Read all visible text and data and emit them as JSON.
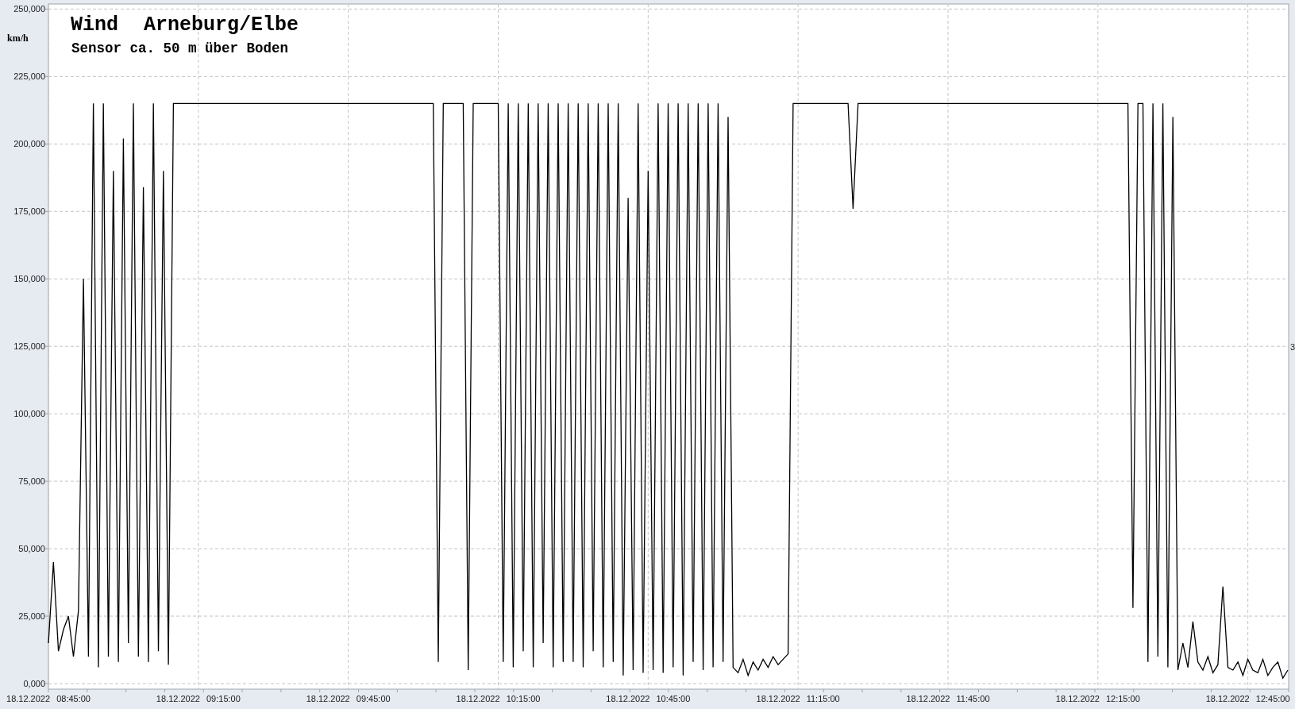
{
  "chart": {
    "title_parts": [
      "Wind",
      "Arneburg/Elbe"
    ],
    "subtitle": "Sensor ca. 50 m über Boden",
    "right_marker": "3",
    "chart_data": {
      "type": "line",
      "ylabel": "km/h",
      "ylim": [
        0,
        250000
      ],
      "yticks": [
        {
          "value": 0,
          "label": "0,000"
        },
        {
          "value": 25000,
          "label": "25,000"
        },
        {
          "value": 50000,
          "label": "50,000"
        },
        {
          "value": 75000,
          "label": "75,000"
        },
        {
          "value": 100000,
          "label": "100,000"
        },
        {
          "value": 125000,
          "label": "125,000"
        },
        {
          "value": 150000,
          "label": "150,000"
        },
        {
          "value": 175000,
          "label": "175,000"
        },
        {
          "value": 200000,
          "label": "200,000"
        },
        {
          "value": 225000,
          "label": "225,000"
        },
        {
          "value": 250000,
          "label": "250,000"
        }
      ],
      "categories": [
        "18.12.2022 08:45:00",
        null,
        null,
        null,
        null,
        null,
        null,
        null,
        null,
        null,
        null,
        null,
        null,
        null,
        null,
        null,
        null,
        null,
        null,
        null,
        null,
        null,
        null,
        null,
        null,
        null,
        null,
        null,
        null,
        null,
        "18.12.2022 09:15:00",
        null,
        null,
        null,
        null,
        null,
        null,
        null,
        null,
        null,
        null,
        null,
        null,
        null,
        null,
        null,
        null,
        null,
        null,
        null,
        null,
        null,
        null,
        null,
        null,
        null,
        null,
        null,
        null,
        null,
        "18.12.2022 09:45:00",
        null,
        null,
        null,
        null,
        null,
        null,
        null,
        null,
        null,
        null,
        null,
        null,
        null,
        null,
        null,
        null,
        null,
        null,
        null,
        null,
        null,
        null,
        null,
        null,
        null,
        null,
        null,
        null,
        null,
        "18.12.2022 10:15:00",
        null,
        null,
        null,
        null,
        null,
        null,
        null,
        null,
        null,
        null,
        null,
        null,
        null,
        null,
        null,
        null,
        null,
        null,
        null,
        null,
        null,
        null,
        null,
        null,
        null,
        null,
        null,
        null,
        null,
        "18.12.2022 10:45:00",
        null,
        null,
        null,
        null,
        null,
        null,
        null,
        null,
        null,
        null,
        null,
        null,
        null,
        null,
        null,
        null,
        null,
        null,
        null,
        null,
        null,
        null,
        null,
        null,
        null,
        null,
        null,
        null,
        null,
        "18.12.2022 11:15:00",
        null,
        null,
        null,
        null,
        null,
        null,
        null,
        null,
        null,
        null,
        null,
        null,
        null,
        null,
        null,
        null,
        null,
        null,
        null,
        null,
        null,
        null,
        null,
        null,
        null,
        null,
        null,
        null,
        null,
        "18.12.2022 11:45:00",
        null,
        null,
        null,
        null,
        null,
        null,
        null,
        null,
        null,
        null,
        null,
        null,
        null,
        null,
        null,
        null,
        null,
        null,
        null,
        null,
        null,
        null,
        null,
        null,
        null,
        null,
        null,
        null,
        null,
        "18.12.2022 12:15:00",
        null,
        null,
        null,
        null,
        null,
        null,
        null,
        null,
        null,
        null,
        null,
        null,
        null,
        null,
        null,
        null,
        null,
        null,
        null,
        null,
        null,
        null,
        null,
        null,
        null,
        null,
        null,
        null,
        null,
        "18.12.2022 12:45:00",
        null,
        null,
        null,
        null,
        null,
        null,
        null,
        null
      ],
      "grid": true,
      "series": [
        {
          "color": "#000000",
          "values": [
            15000,
            45000,
            12000,
            20000,
            25000,
            10000,
            27000,
            150000,
            10000,
            215000,
            6000,
            215000,
            10000,
            190000,
            8000,
            202000,
            15000,
            215000,
            10000,
            184000,
            8000,
            215000,
            12000,
            190000,
            7000,
            215000,
            215000,
            215000,
            215000,
            215000,
            215000,
            215000,
            215000,
            215000,
            215000,
            215000,
            215000,
            215000,
            215000,
            215000,
            215000,
            215000,
            215000,
            215000,
            215000,
            215000,
            215000,
            215000,
            215000,
            215000,
            215000,
            215000,
            215000,
            215000,
            215000,
            215000,
            215000,
            215000,
            215000,
            215000,
            215000,
            215000,
            215000,
            215000,
            215000,
            215000,
            215000,
            215000,
            215000,
            215000,
            215000,
            215000,
            215000,
            215000,
            215000,
            215000,
            215000,
            215000,
            8000,
            215000,
            215000,
            215000,
            215000,
            215000,
            5000,
            215000,
            215000,
            215000,
            215000,
            215000,
            215000,
            8000,
            215000,
            6000,
            215000,
            12000,
            215000,
            6000,
            215000,
            15000,
            215000,
            6000,
            215000,
            8000,
            215000,
            8000,
            215000,
            6000,
            215000,
            12000,
            215000,
            6000,
            215000,
            8000,
            215000,
            3000,
            180000,
            5000,
            215000,
            4000,
            190000,
            5000,
            215000,
            4000,
            215000,
            6000,
            215000,
            3000,
            215000,
            8000,
            215000,
            5000,
            215000,
            6000,
            215000,
            8000,
            210000,
            6000,
            4000,
            9000,
            3000,
            8000,
            5000,
            9000,
            6000,
            10000,
            7000,
            9000,
            11000,
            215000,
            215000,
            215000,
            215000,
            215000,
            215000,
            215000,
            215000,
            215000,
            215000,
            215000,
            215000,
            176000,
            215000,
            215000,
            215000,
            215000,
            215000,
            215000,
            215000,
            215000,
            215000,
            215000,
            215000,
            215000,
            215000,
            215000,
            215000,
            215000,
            215000,
            215000,
            215000,
            215000,
            215000,
            215000,
            215000,
            215000,
            215000,
            215000,
            215000,
            215000,
            215000,
            215000,
            215000,
            215000,
            215000,
            215000,
            215000,
            215000,
            215000,
            215000,
            215000,
            215000,
            215000,
            215000,
            215000,
            215000,
            215000,
            215000,
            215000,
            215000,
            215000,
            215000,
            215000,
            215000,
            215000,
            215000,
            215000,
            28000,
            215000,
            215000,
            8000,
            215000,
            10000,
            215000,
            6000,
            210000,
            5000,
            15000,
            6000,
            23000,
            8000,
            5000,
            10000,
            4000,
            7000,
            36000,
            6000,
            5000,
            8000,
            3000,
            9000,
            5000,
            4000,
            9000,
            3000,
            6000,
            8000,
            2000,
            5000
          ]
        }
      ]
    }
  }
}
